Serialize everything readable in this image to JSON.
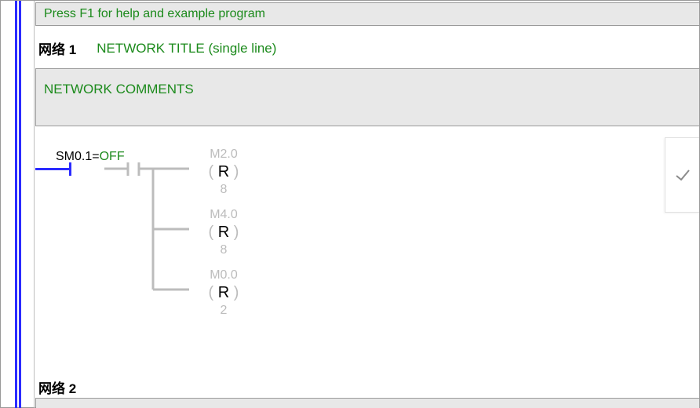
{
  "help_hint": "Press F1 for help and example program",
  "network1": {
    "label": "网络 1",
    "title": "NETWORK TITLE (single line)",
    "comments": "NETWORK COMMENTS",
    "contact": {
      "addr": "SM0.1",
      "eq": "=",
      "state": "OFF"
    },
    "coils": [
      {
        "addr": "M2.0",
        "type": "R",
        "count": "8"
      },
      {
        "addr": "M4.0",
        "type": "R",
        "count": "8"
      },
      {
        "addr": "M0.0",
        "type": "R",
        "count": "2"
      }
    ]
  },
  "network2": {
    "label": "网络 2"
  }
}
